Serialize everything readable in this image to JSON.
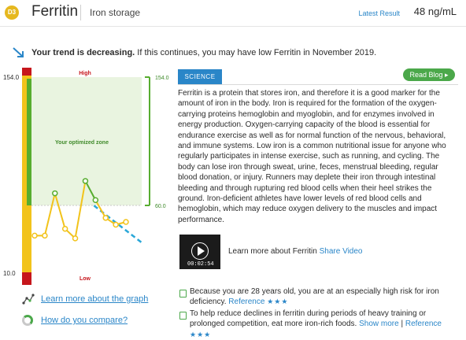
{
  "header": {
    "badge": "D3",
    "title": "Ferritin",
    "subtitle": "Iron storage",
    "latest_label": "Latest Result",
    "latest_value": "48 ng/mL"
  },
  "trend": {
    "bold": "Your trend is decreasing.",
    "rest": " If this continues, you may have low Ferritin in November 2019."
  },
  "chart": {
    "top_value": "154.0",
    "bottom_value": "10.0",
    "high_label": "High",
    "low_label": "Low",
    "zone_label": "Your optimized zone",
    "zone_top": "154.0",
    "zone_bottom": "60.0",
    "colors": {
      "high": "#c6161c",
      "optimal": "#57ad2f",
      "warning": "#f2c31b",
      "zone": "#e9f4e0",
      "trend": "#2aa7d8"
    }
  },
  "chart_data": {
    "type": "line",
    "y_range": [
      10.0,
      154.0
    ],
    "optimized_zone": [
      60.0,
      154.0
    ],
    "series": [
      {
        "values": [
          38,
          38,
          69,
          43,
          36,
          78,
          64,
          51,
          46,
          48
        ]
      }
    ],
    "trend_line": [
      60,
      32
    ]
  },
  "science": {
    "tab_label": "SCIENCE",
    "read_blog": "Read Blog ▸",
    "text": "Ferritin is a protein that stores iron, and therefore it is a good marker for the amount of iron in the body. Iron is required for the formation of the oxygen-carrying proteins hemoglobin and myoglobin, and for enzymes involved in energy production. Oxygen-carrying capacity of the blood is essential for endurance exercise as well as for normal function of the nervous, behavioral, and immune systems. Low iron is a common nutritional issue for anyone who regularly participates in intense exercise, such as running, and cycling. The body can lose iron through sweat, urine, feces, menstrual bleeding, regular blood donation, or injury. Runners may deplete their iron through intestinal bleeding and through rupturing red blood cells when their heel strikes the ground. Iron-deficient athletes have lower levels of red blood cells and hemoglobin, which may reduce oxygen delivery to the muscles and impact performance."
  },
  "video": {
    "time": "00:02:54",
    "text": "Learn more about Ferritin",
    "link": "Share Video"
  },
  "tips": [
    {
      "text": "Because you are 28 years old, you are at an especially high risk for iron deficiency. ",
      "link1": "Reference",
      "stars": "★★★"
    },
    {
      "text": "To help reduce declines in ferritin during periods of heavy training or prolonged competition, eat more iron-rich foods. ",
      "link1": "Show more",
      "sep": " | ",
      "link2": "Reference",
      "stars": "★★★"
    }
  ],
  "links": {
    "graph": "Learn more about the graph",
    "compare": "How do you compare?"
  }
}
